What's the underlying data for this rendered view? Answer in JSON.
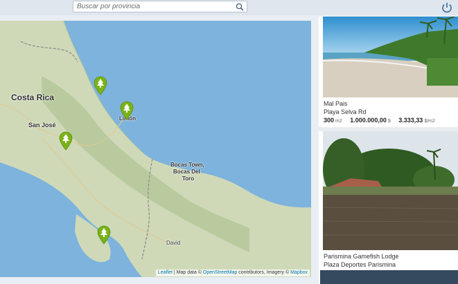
{
  "search": {
    "placeholder": "Buscar por provincia"
  },
  "map": {
    "labels": {
      "country": "Costa Rica",
      "san_jose": "San José",
      "limon": "Limón",
      "bocas_line1": "Bocas Town,",
      "bocas_line2": "Bocas Del",
      "bocas_line3": "Toro",
      "david": "David"
    },
    "markers": [
      "tree-marker",
      "tree-marker",
      "tree-marker",
      "tree-marker"
    ],
    "attribution": {
      "leaflet": "Leaflet",
      "map_data": "| Map data ©",
      "osm": "OpenStreetMap",
      "contributors": "contributors, Imagery ©",
      "mapbox": "Mapbox"
    }
  },
  "listings": [
    {
      "title": "Mal Pais",
      "address": "Playa Selva Rd",
      "area": "300",
      "area_unit": "m2",
      "price": "1.000.000,00",
      "price_unit": "$",
      "price_per_m2": "3.333,33",
      "price_per_m2_unit": "$/m2"
    },
    {
      "title": "Parismina Gamefish Lodge",
      "address": "Plaza Deportes Parismina"
    }
  ],
  "colors": {
    "accent": "#354a5f",
    "marker": "#7ab317",
    "water": "#7db3dc",
    "land": "#cfd9b8"
  }
}
